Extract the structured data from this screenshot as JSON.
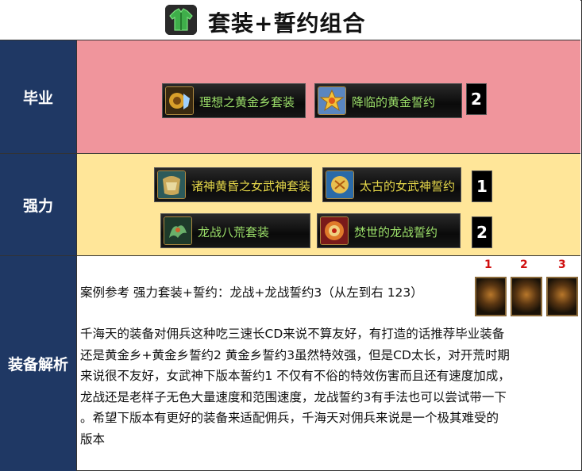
{
  "title": "套装+誓约组合",
  "rows": {
    "graduation": {
      "label": "毕业",
      "items": [
        "理想之黄金乡套装",
        "降临的黄金誓约"
      ],
      "count": "2"
    },
    "strong": {
      "label": "强力",
      "items": [
        "诸神黄昏之女武神套装",
        "太古的女武神誓约",
        "龙战八荒套装",
        "焚世的龙战誓约"
      ],
      "count_1": "1",
      "count_2": "2"
    },
    "analysis": {
      "label": "装备解析",
      "example": "案例参考 强力套装+誓约：龙战+龙战誓约3（从左到右 123）",
      "slot_numbers": [
        "1",
        "2",
        "3"
      ],
      "lines": [
        "千海天的装备对佣兵这种吃三速长CD来说不算友好，有打造的话推荐毕业装备",
        "还是黄金乡+黄金乡誓约2 黄金乡誓约3虽然特效强，但是CD太长，对开荒时期",
        "来说很不友好，女武神下版本誓约1 不仅有不俗的特效伤害而且还有速度加成，",
        "龙战还是老样子无色大量速度和范围速度，龙战誓约3有手法也可以尝试带一下",
        "。希望下版本有更好的装备来适配佣兵，千海天对佣兵来说是一个极其难受的",
        "版本"
      ]
    }
  },
  "colors": {
    "header_bg": "#1f3864",
    "graduation_bg": "#f0959c",
    "strong_bg": "#ffe699",
    "item_text_green": "#9ce06a",
    "item_text_yellow": "#e6d84a",
    "slot_number_red": "#d01010"
  },
  "icons": [
    "armor-set-icon",
    "golden-town-set-icon",
    "golden-pledge-icon",
    "valkyrie-set-icon",
    "valkyrie-pledge-icon",
    "dragon-war-set-icon",
    "dragon-pledge-icon",
    "pledge-slot-icon"
  ]
}
